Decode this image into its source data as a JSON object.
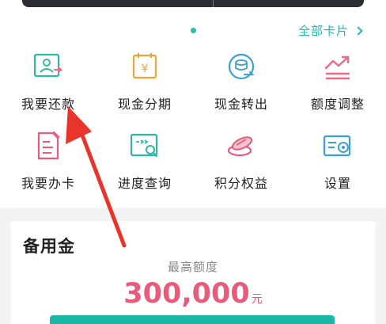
{
  "carousel": {
    "all_cards_label": "全部卡片"
  },
  "grid": {
    "items": [
      {
        "label": "我要还款",
        "icon": "repay-icon"
      },
      {
        "label": "现金分期",
        "icon": "cash-installment-icon"
      },
      {
        "label": "现金转出",
        "icon": "cash-transfer-icon"
      },
      {
        "label": "额度调整",
        "icon": "limit-adjust-icon"
      },
      {
        "label": "我要办卡",
        "icon": "apply-card-icon"
      },
      {
        "label": "进度查询",
        "icon": "progress-query-icon"
      },
      {
        "label": "积分权益",
        "icon": "points-rights-icon"
      },
      {
        "label": "设置",
        "icon": "settings-icon"
      }
    ]
  },
  "reserve": {
    "title": "备用金",
    "limit_label": "最高额度",
    "amount": "300,000",
    "unit": "元"
  },
  "colors": {
    "accent": "#22b9ad",
    "amount": "#e85b7a",
    "arrow": "#e8342a"
  }
}
